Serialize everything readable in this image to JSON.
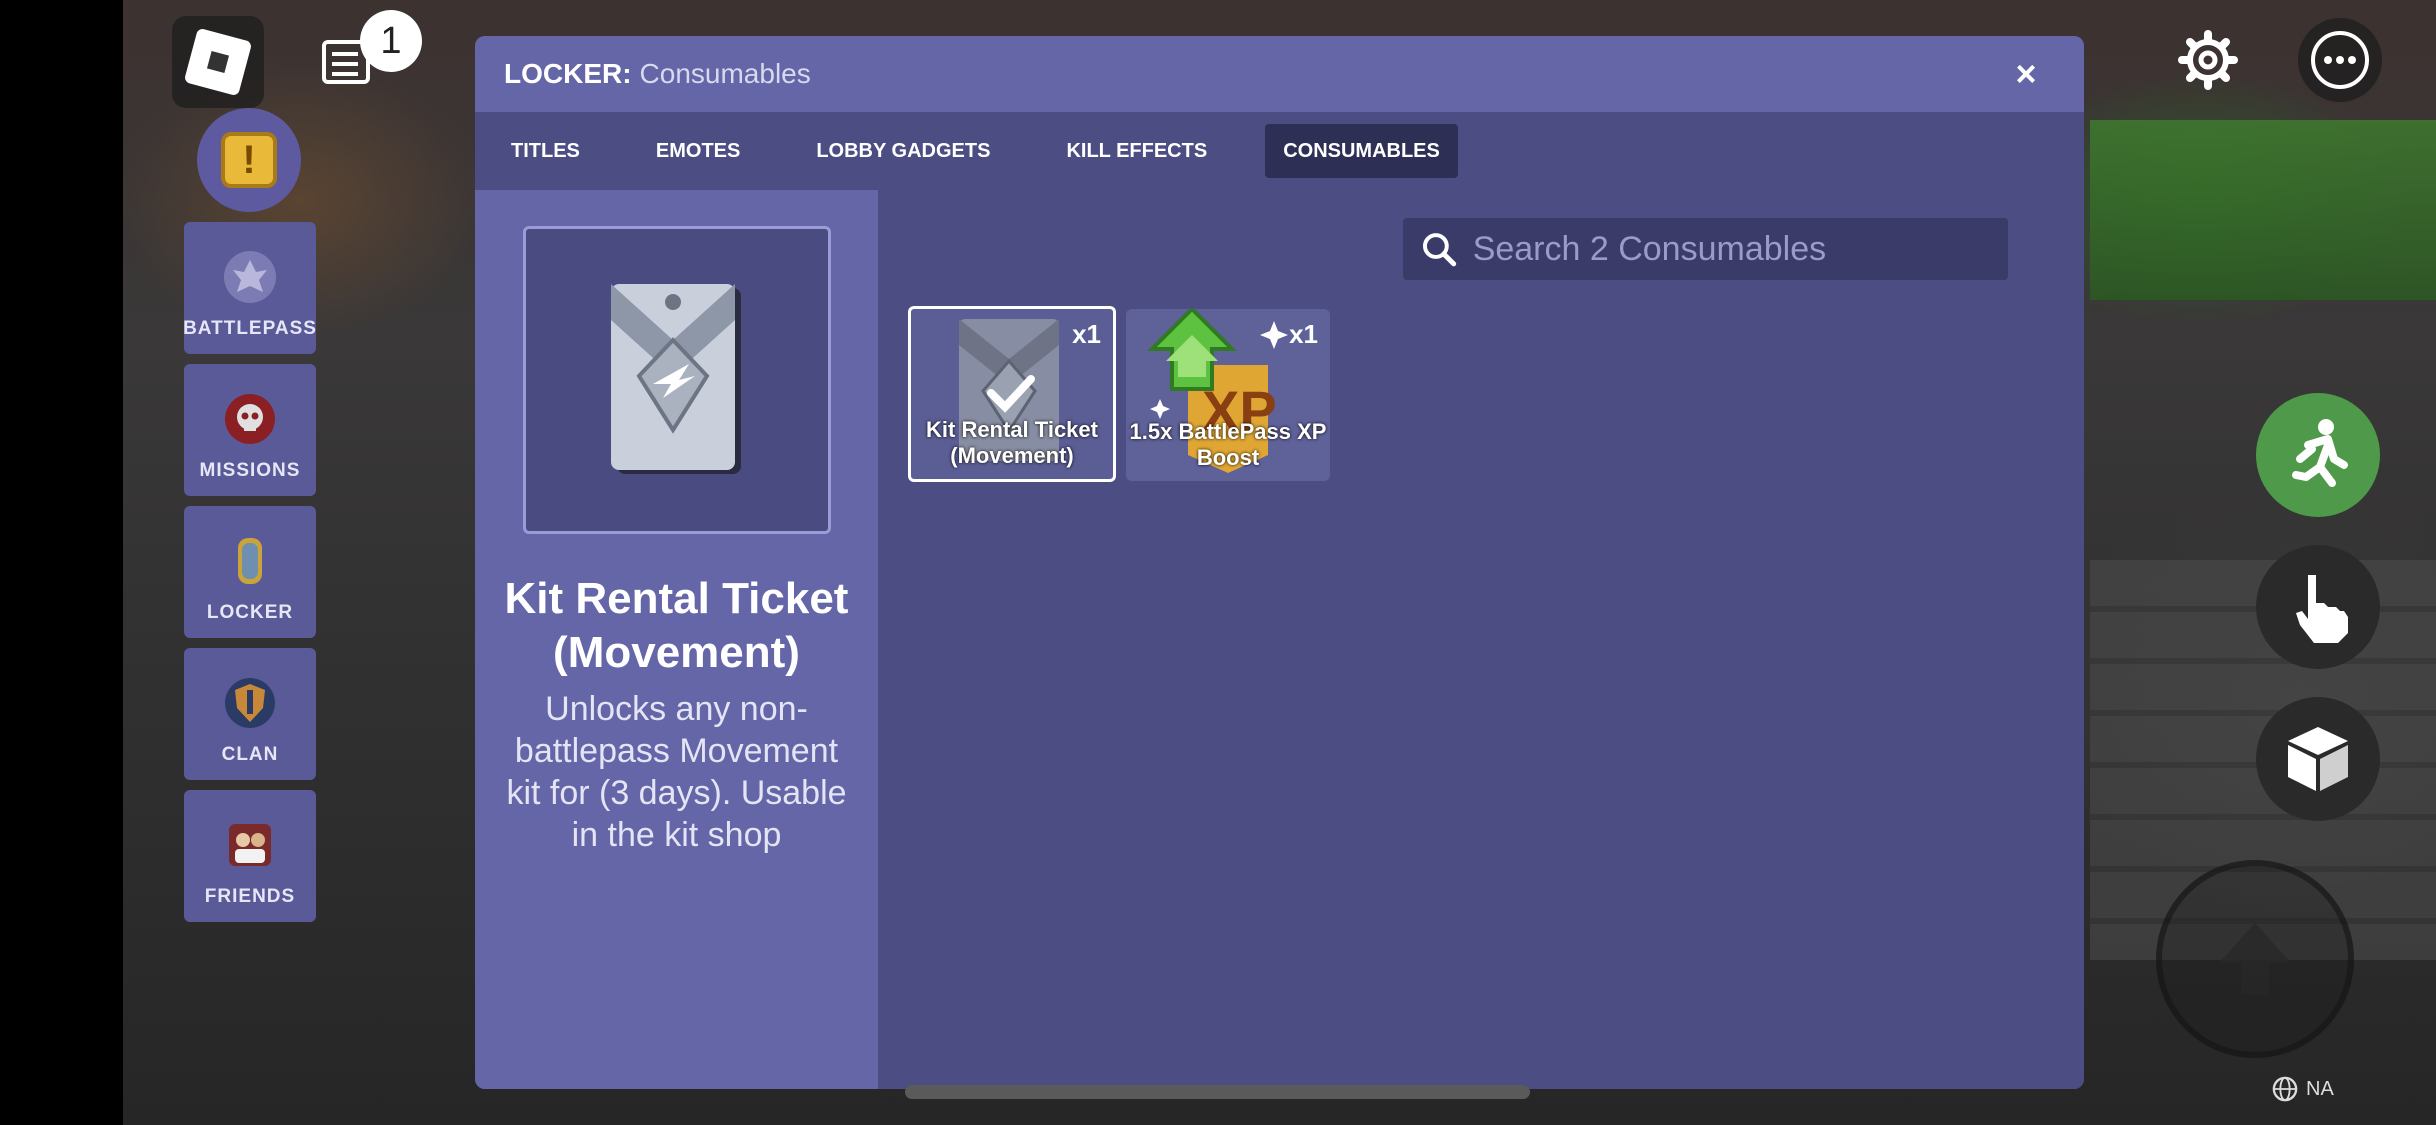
{
  "hud": {
    "notification_count": "1",
    "region_label": "NA"
  },
  "sidebar": {
    "items": [
      {
        "label": "BATTLEPASS",
        "icon": "battlepass-crest-icon"
      },
      {
        "label": "MISSIONS",
        "icon": "skull-icon"
      },
      {
        "label": "LOCKER",
        "icon": "locker-icon"
      },
      {
        "label": "CLAN",
        "icon": "clan-shield-icon"
      },
      {
        "label": "FRIENDS",
        "icon": "friends-icon"
      }
    ]
  },
  "locker": {
    "title_prefix": "LOCKER:",
    "title_section": "Consumables",
    "close_label": "×",
    "tabs": [
      "TITLES",
      "EMOTES",
      "LOBBY GADGETS",
      "KILL EFFECTS",
      "CONSUMABLES"
    ],
    "active_tab": "CONSUMABLES",
    "search_placeholder": "Search 2 Consumables",
    "selected": {
      "name": "Kit Rental Ticket (Movement)",
      "description": "Unlocks any non-battlepass Movement kit for (3 days). Usable in the kit shop"
    },
    "items": [
      {
        "name": "Kit Rental Ticket (Movement)",
        "count": "x1",
        "selected": true
      },
      {
        "name": "1.5x BattlePass XP Boost",
        "count": "x1",
        "selected": false
      }
    ]
  },
  "colors": {
    "panel": "#6466a8",
    "tab_bar": "#4c4d82",
    "active_tab": "#2e2f55",
    "sprint_button": "#4f9a4a"
  }
}
